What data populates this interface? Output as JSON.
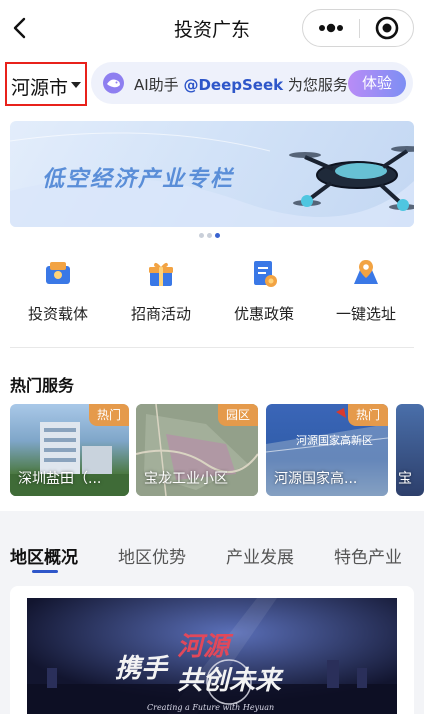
{
  "nav": {
    "title": "投资广东",
    "back_icon": "back-chevron-icon",
    "more_icon": "more-dots-icon",
    "close_icon": "target-close-icon"
  },
  "location": {
    "city": "河源市",
    "caret_icon": "caret-down-icon"
  },
  "ai": {
    "icon": "deepseek-whale-icon",
    "prefix": "AI助手 ",
    "handle": "@DeepSeek",
    "suffix": " 为您服务",
    "button": "体验"
  },
  "banner": {
    "title": "低空经济产业专栏",
    "slide_count": 3,
    "active_slide": 3
  },
  "quick_actions": [
    {
      "label": "投资载体",
      "icon": "investment-carrier-icon"
    },
    {
      "label": "招商活动",
      "icon": "gift-event-icon"
    },
    {
      "label": "优惠政策",
      "icon": "policy-document-icon"
    },
    {
      "label": "一键选址",
      "icon": "location-select-icon"
    }
  ],
  "hot_services": {
    "title": "热门服务",
    "cards": [
      {
        "name": "深圳盐田（...",
        "badge": "热门"
      },
      {
        "name": "宝龙工业小区",
        "badge": "园区"
      },
      {
        "name": "河源国家高...",
        "badge": "热门",
        "sign_text": "河源国家高新区"
      },
      {
        "name": "宝",
        "badge": ""
      }
    ]
  },
  "tabs": [
    {
      "label": "地区概况",
      "active": true
    },
    {
      "label": "地区优势",
      "active": false
    },
    {
      "label": "产业发展",
      "active": false
    },
    {
      "label": "特色产业",
      "active": false
    }
  ],
  "video": {
    "slogan_left": "携手",
    "slogan_highlight": "河源",
    "slogan_bottom": "共创未来",
    "subtitle": "Creating a Future with Heyuan"
  },
  "colors": {
    "accent_blue": "#2e56c9",
    "highlight_red": "#e8211b",
    "badge_orange": "#e59a4b",
    "ai_purple": "#9d8cf5"
  }
}
